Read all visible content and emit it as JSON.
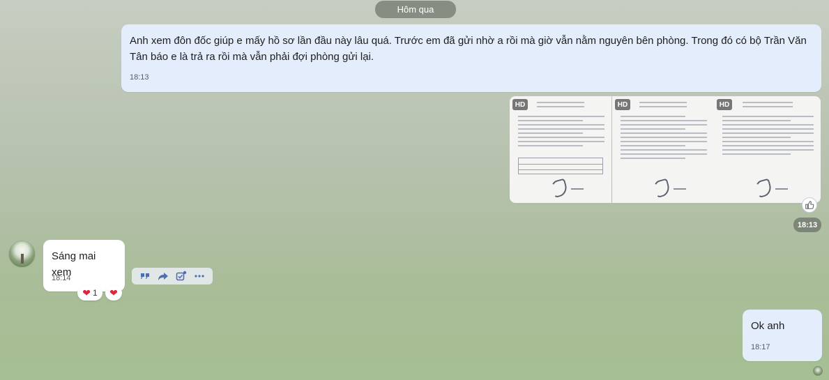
{
  "date_separator": "Hôm qua",
  "messages": [
    {
      "direction": "outgoing",
      "text": "Anh xem đôn đốc giúp e mấy hồ sơ lần đầu này lâu quá. Trước em đã gửi nhờ a rồi mà giờ vẫn nằm nguyên bên phòng. Trong đó có bộ Trần Văn Tân báo e là trả ra rồi mà vẫn phải đợi phòng gửi lại.",
      "time": "18:13"
    },
    {
      "direction": "incoming",
      "text": "Sáng mai xem",
      "time": "18:14"
    },
    {
      "direction": "outgoing",
      "text": "Ok anh",
      "time": "18:17"
    }
  ],
  "image_group": {
    "images": [
      {
        "badge": "HD"
      },
      {
        "badge": "HD"
      },
      {
        "badge": "HD"
      }
    ],
    "time": "18:13"
  },
  "reactions": [
    {
      "icon": "heart-icon",
      "count": "1"
    },
    {
      "icon": "heart-icon",
      "count": ""
    }
  ],
  "colors": {
    "outgoing_bubble": "#e3edfc",
    "incoming_bubble": "#ffffff",
    "heart": "#e0253b"
  }
}
